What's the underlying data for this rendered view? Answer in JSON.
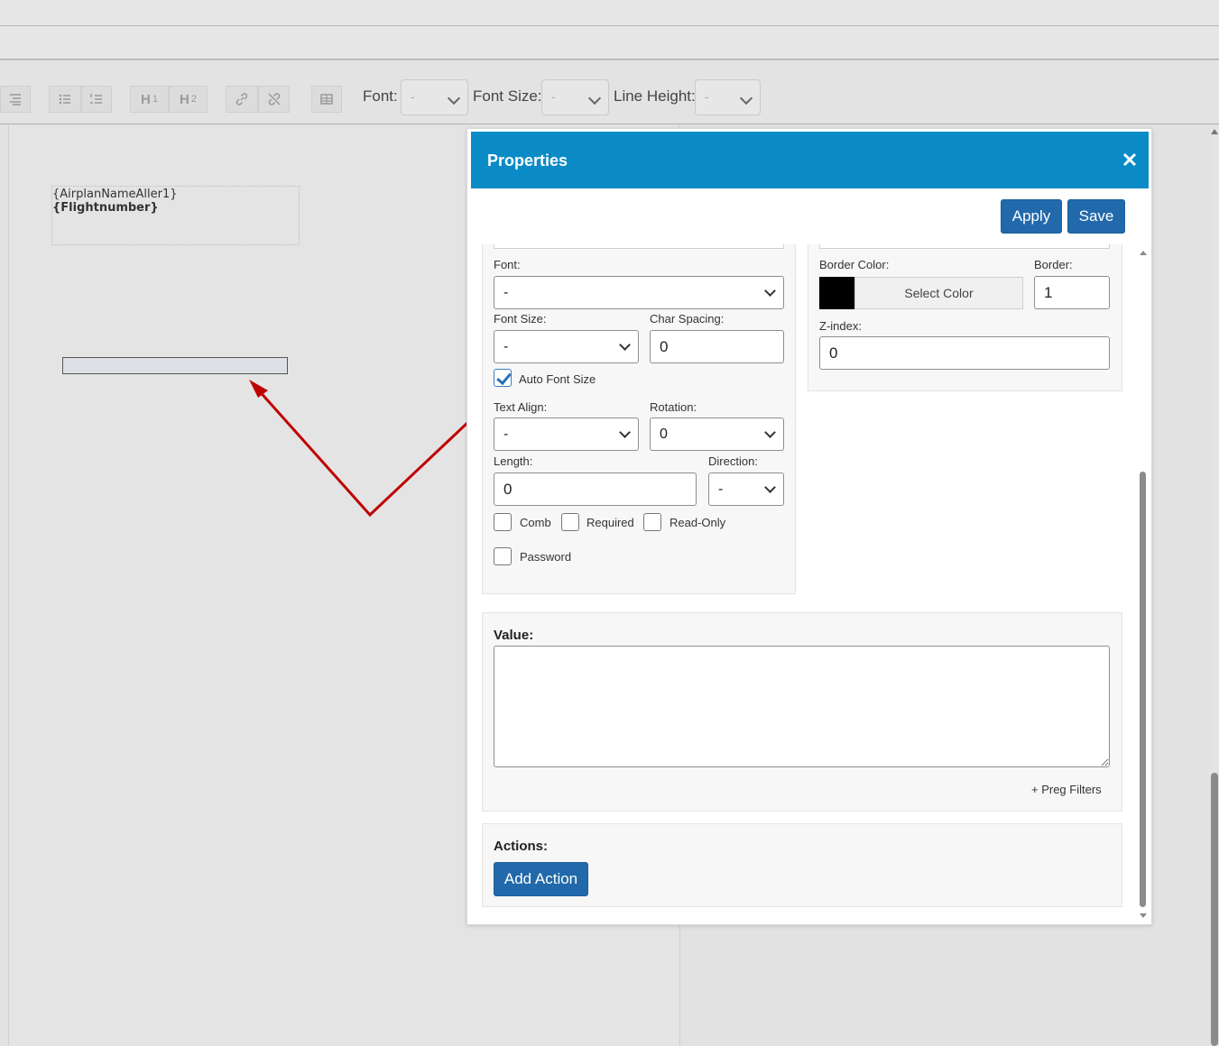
{
  "toolbar": {
    "font_label": "Font:",
    "font_value": "-",
    "font_size_label": "Font Size:",
    "font_size_value": "-",
    "line_height_label": "Line Height:",
    "line_height_value": "-",
    "h1_label": "H",
    "h1_num": "1",
    "h2_label": "H",
    "h2_num": "2",
    "icons": [
      "align-icon",
      "bullet-list-icon",
      "numbered-list-icon",
      "heading1-icon",
      "heading2-icon",
      "link-icon",
      "unlink-icon",
      "table-icon"
    ]
  },
  "document": {
    "field_line1": "{AirplanNameAller1}",
    "field_line2": "{Flightnumber}"
  },
  "dialog": {
    "title": "Properties",
    "apply_label": "Apply",
    "save_label": "Save",
    "font_label": "Font:",
    "font_value": "-",
    "font_size_label": "Font Size:",
    "font_size_value": "-",
    "char_spacing_label": "Char Spacing:",
    "char_spacing_value": "0",
    "auto_font_size_label": "Auto Font Size",
    "auto_font_size_checked": true,
    "text_align_label": "Text Align:",
    "text_align_value": "-",
    "rotation_label": "Rotation:",
    "rotation_value": "0",
    "length_label": "Length:",
    "length_value": "0",
    "direction_label": "Direction:",
    "direction_value": "-",
    "comb_label": "Comb",
    "required_label": "Required",
    "readonly_label": "Read-Only",
    "password_label": "Password",
    "border_color_label": "Border Color:",
    "border_color_value": "#000000",
    "select_color_label": "Select Color",
    "border_label": "Border:",
    "border_value": "1",
    "zindex_label": "Z-index:",
    "zindex_value": "0",
    "value_label": "Value:",
    "value_text": "",
    "preg_filters_label": "+ Preg Filters",
    "actions_label": "Actions:",
    "add_action_label": "Add Action"
  },
  "colors": {
    "header_blue": "#0a8bc6",
    "button_blue": "#2169aa",
    "arrow_red": "#c00000"
  }
}
